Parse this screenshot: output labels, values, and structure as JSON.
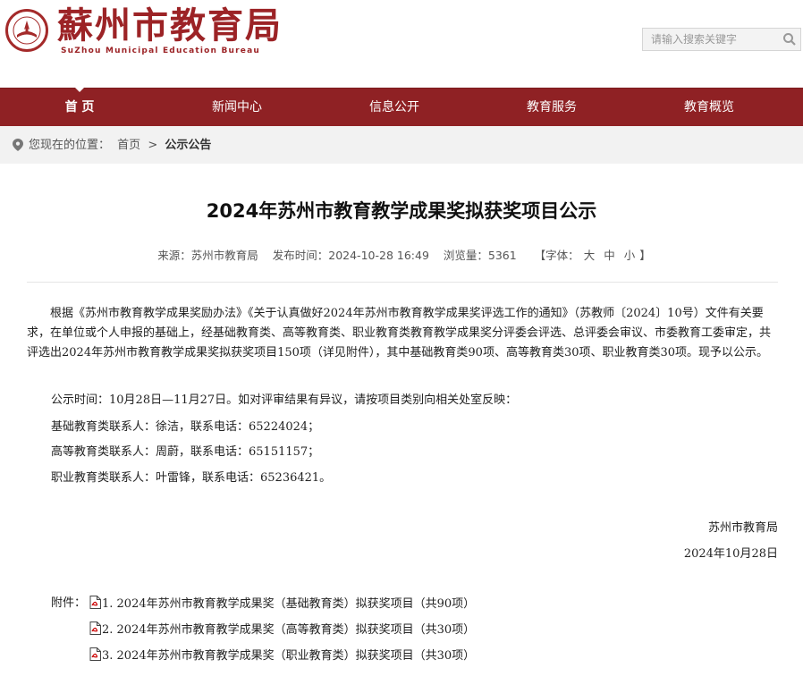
{
  "header": {
    "logo_cn": "蘇州市教育局",
    "logo_en": "SuZhou Municipal Education Bureau",
    "search_placeholder": "请输入搜索关键字"
  },
  "nav": {
    "items": [
      {
        "label": "首 页"
      },
      {
        "label": "新闻中心"
      },
      {
        "label": "信息公开"
      },
      {
        "label": "教育服务"
      },
      {
        "label": "教育概览"
      }
    ]
  },
  "breadcrumb": {
    "prefix": "您现在的位置：",
    "home": "首页",
    "sep": ">",
    "current": "公示公告"
  },
  "article": {
    "title": "2024年苏州市教育教学成果奖拟获奖项目公示",
    "meta": {
      "source": "来源：苏州市教育局",
      "time": "发布时间：2024-10-28 16:49",
      "views": "浏览量：5361",
      "font_label": "【字体：",
      "font_large": "大",
      "font_medium": "中",
      "font_small": "小",
      "font_end": "】"
    },
    "para1": "根据《苏州市教育教学成果奖励办法》《关于认真做好2024年苏州市教育教学成果奖评选工作的通知》（苏教师〔2024〕10号）文件有关要求，在单位或个人申报的基础上，经基础教育类、高等教育类、职业教育类教育教学成果奖分评委会评选、总评委会审议、市委教育工委审定，共评选出2024年苏州市教育教学成果奖拟获奖项目150项（详见附件），其中基础教育类90项、高等教育类30项、职业教育类30项。现予以公示。",
    "para2": "公示时间：10月28日—11月27日。如对评审结果有异议，请按项目类别向相关处室反映：",
    "contact1": "基础教育类联系人：徐洁，联系电话：65224024；",
    "contact2": "高等教育类联系人：周蔚，联系电话：65151157；",
    "contact3": "职业教育类联系人：叶雷锋，联系电话：65236421。",
    "sign_org": "苏州市教育局",
    "sign_date": "2024年10月28日",
    "attach_label": "附件：",
    "attachments": [
      "1. 2024年苏州市教育教学成果奖（基础教育类）拟获奖项目（共90项）",
      "2. 2024年苏州市教育教学成果奖（高等教育类）拟获奖项目（共30项）",
      "3. 2024年苏州市教育教学成果奖（职业教育类）拟获奖项目（共30项）"
    ]
  }
}
